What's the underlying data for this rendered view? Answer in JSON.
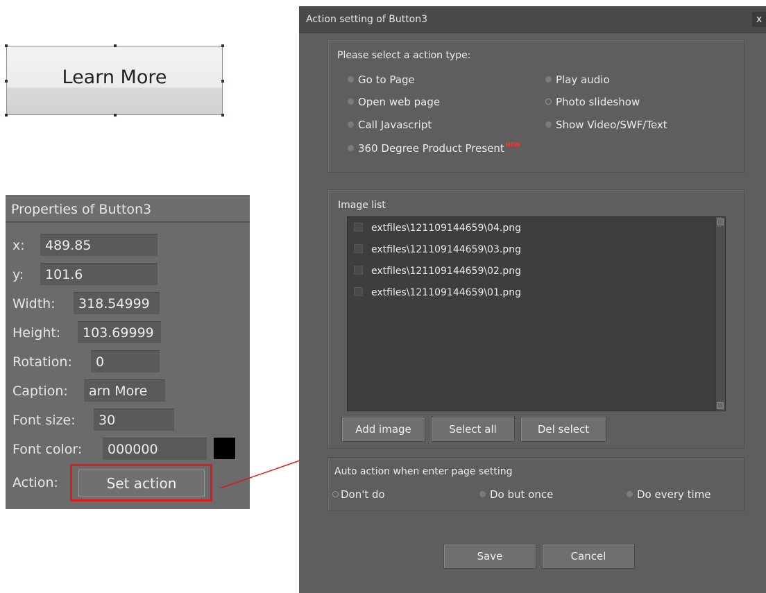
{
  "preview": {
    "button_caption": "Learn More"
  },
  "properties": {
    "title": "Properties of Button3",
    "rows": [
      {
        "label": "x:",
        "value": "489.85"
      },
      {
        "label": "y:",
        "value": "101.6"
      },
      {
        "label": "Width:",
        "value": "318.54999"
      },
      {
        "label": "Height:",
        "value": "103.69999"
      },
      {
        "label": "Rotation:",
        "value": "0"
      },
      {
        "label": "Caption:",
        "value": "arn More"
      },
      {
        "label": "Font size:",
        "value": "30"
      },
      {
        "label": "Font color:",
        "value": "000000"
      }
    ],
    "font_color_swatch": "#000000",
    "action_label": "Action:",
    "set_action_button": "Set action"
  },
  "dialog": {
    "title": "Action setting of Button3",
    "close": "x",
    "action_type": {
      "heading": "Please select a action type:",
      "options_left": [
        "Go to Page",
        "Open web page",
        "Call Javascript",
        "360 Degree Product Present"
      ],
      "options_right": [
        "Play audio",
        "Photo slideshow",
        "Show Video/SWF/Text"
      ],
      "new_badge": "NEW",
      "selected": "Photo slideshow"
    },
    "image_list": {
      "heading": "Image list",
      "items": [
        "extfiles\\121109144659\\04.png",
        "extfiles\\121109144659\\03.png",
        "extfiles\\121109144659\\02.png",
        "extfiles\\121109144659\\01.png"
      ],
      "buttons": {
        "add": "Add image",
        "select_all": "Select all",
        "delete": "Del select"
      }
    },
    "auto_action": {
      "heading": "Auto action when enter page setting",
      "options": [
        "Don't do",
        "Do but once",
        "Do every time"
      ],
      "selected": "Don't do"
    },
    "footer": {
      "save": "Save",
      "cancel": "Cancel"
    }
  },
  "colors": {
    "highlight": "#e01818",
    "new_badge": "#ff3030"
  }
}
